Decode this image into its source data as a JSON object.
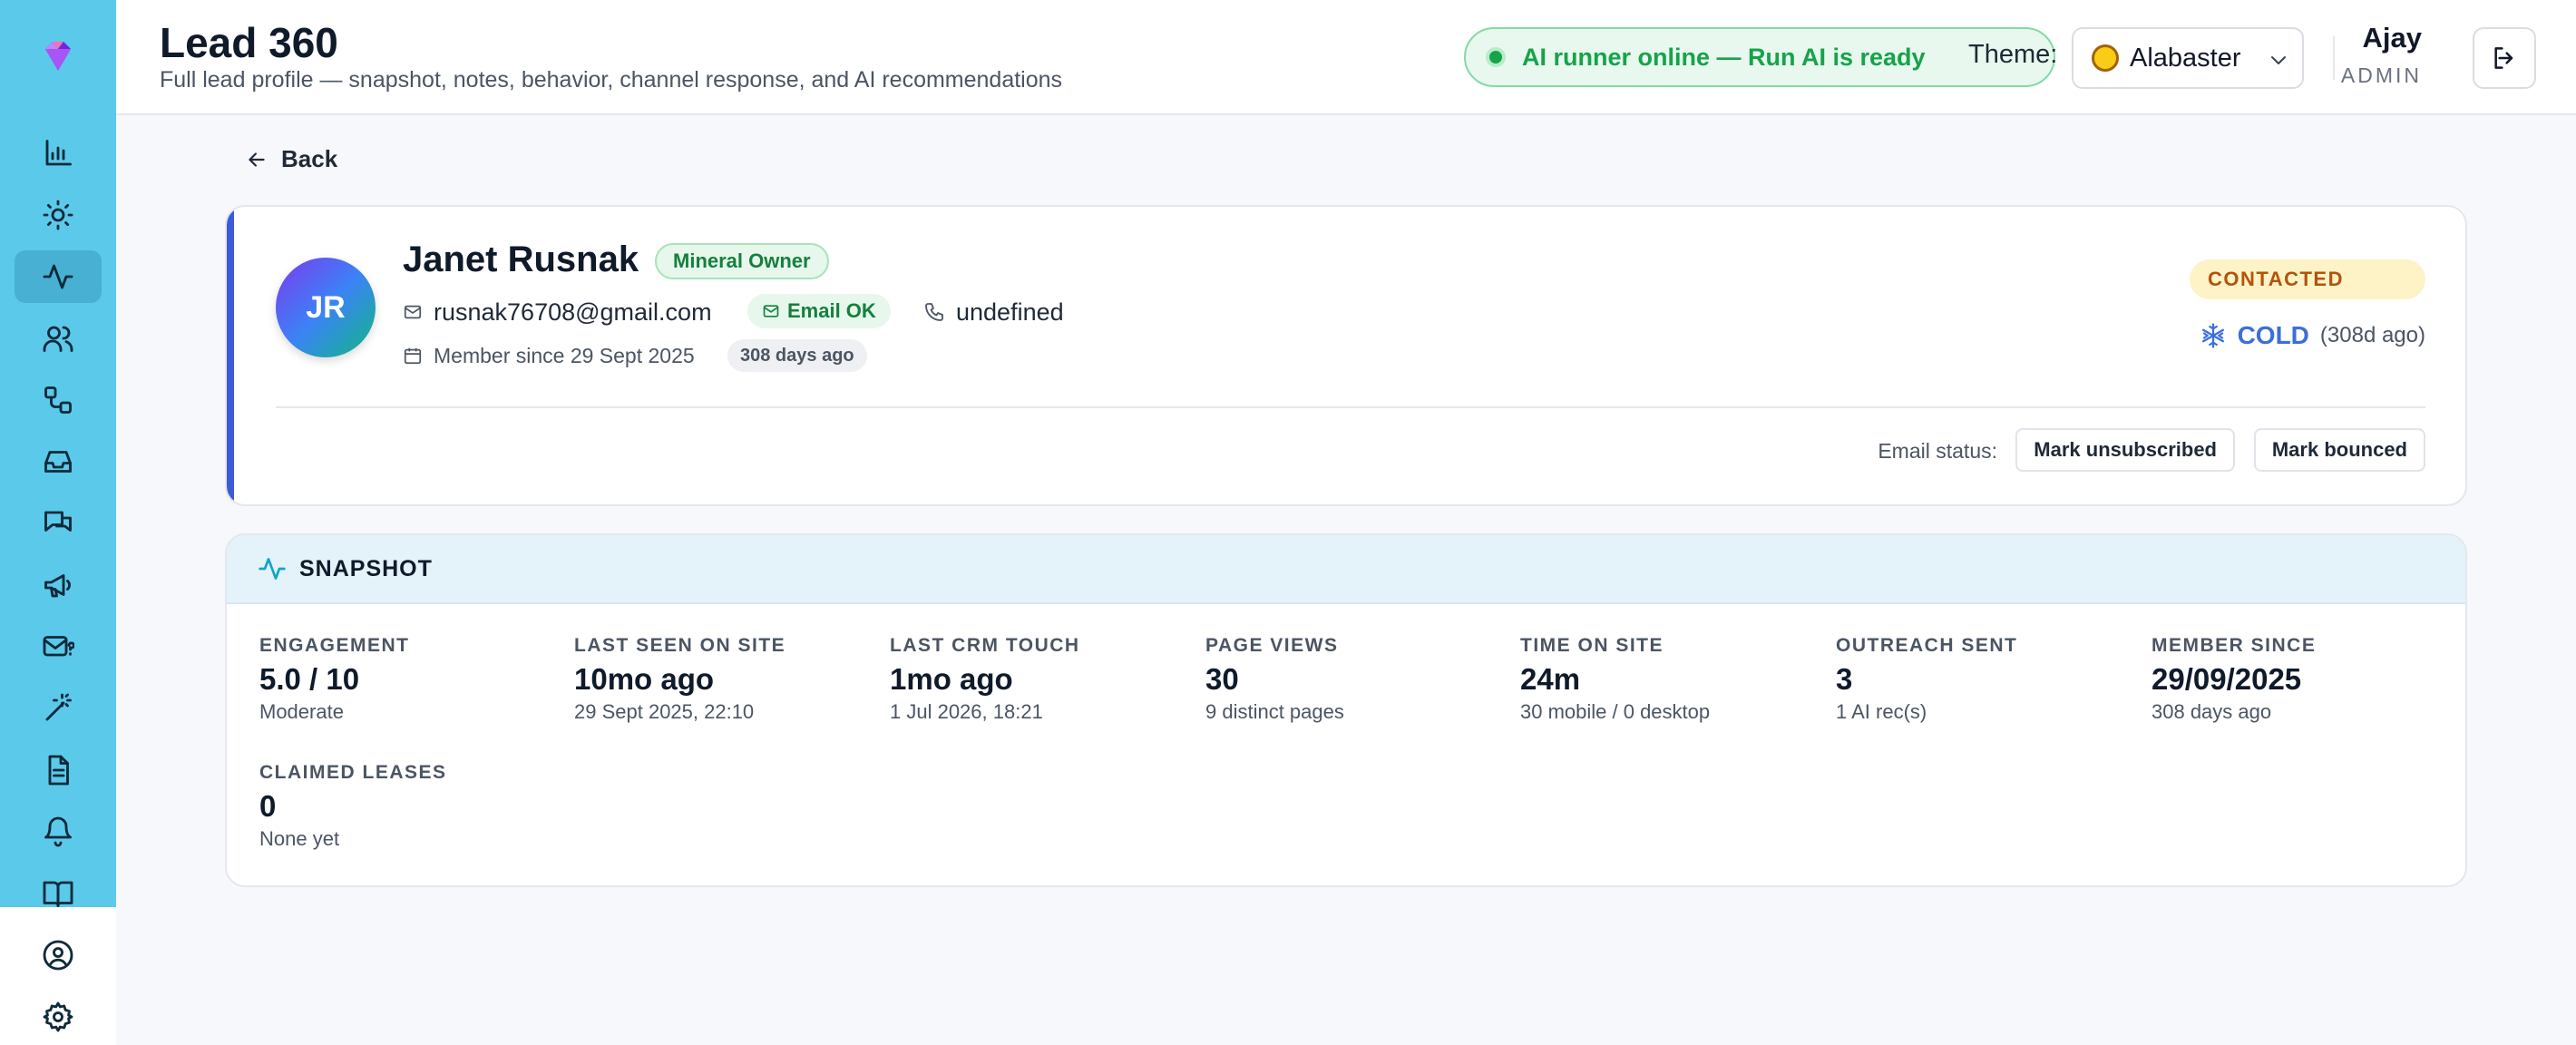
{
  "header": {
    "title": "Lead 360",
    "subtitle": "Full lead profile — snapshot, notes, behavior, channel response, and AI recommendations",
    "ai_status": "AI runner online — Run AI is ready",
    "theme_label": "Theme:",
    "theme_value": "Alabaster",
    "user_name": "Ajay",
    "user_role": "ADMIN",
    "logout_icon": "logout-icon"
  },
  "sidebar": {
    "items": [
      {
        "icon": "bar-chart-icon",
        "active": false
      },
      {
        "icon": "sun-icon",
        "active": false
      },
      {
        "icon": "activity-icon",
        "active": true
      },
      {
        "icon": "users-icon",
        "active": false
      },
      {
        "icon": "workflow-icon",
        "active": false
      },
      {
        "icon": "inbox-icon",
        "active": false
      },
      {
        "icon": "messages-icon",
        "active": false
      },
      {
        "icon": "megaphone-icon",
        "active": false
      },
      {
        "icon": "mail-question-icon",
        "active": false
      },
      {
        "icon": "magic-wand-icon",
        "active": false
      },
      {
        "icon": "document-icon",
        "active": false
      },
      {
        "icon": "bell-icon",
        "active": false
      },
      {
        "icon": "book-icon",
        "active": false
      },
      {
        "icon": "user-circle-icon",
        "active": false
      },
      {
        "icon": "settings-icon",
        "active": false
      }
    ]
  },
  "back_label": "Back",
  "profile": {
    "initials": "JR",
    "name": "Janet Rusnak",
    "role_badge": "Mineral Owner",
    "email": "rusnak76708@gmail.com",
    "email_ok": "Email OK",
    "phone": "undefined",
    "member_since": "Member since 29 Sept 2025",
    "days_ago": "308 days ago",
    "status": "CONTACTED",
    "temperature": "COLD",
    "temperature_age": "(308d ago)",
    "email_status_label": "Email status:",
    "mark_unsubscribed": "Mark unsubscribed",
    "mark_bounced": "Mark bounced"
  },
  "snapshot": {
    "title": "SNAPSHOT",
    "stats": [
      {
        "label": "ENGAGEMENT",
        "value": "5.0 / 10",
        "sub": "Moderate"
      },
      {
        "label": "LAST SEEN ON SITE",
        "value": "10mo ago",
        "sub": "29 Sept 2025, 22:10"
      },
      {
        "label": "LAST CRM TOUCH",
        "value": "1mo ago",
        "sub": "1 Jul 2026, 18:21"
      },
      {
        "label": "PAGE VIEWS",
        "value": "30",
        "sub": "9 distinct pages"
      },
      {
        "label": "TIME ON SITE",
        "value": "24m",
        "sub": "30 mobile / 0 desktop"
      },
      {
        "label": "OUTREACH SENT",
        "value": "3",
        "sub": "1 AI rec(s)"
      },
      {
        "label": "MEMBER SINCE",
        "value": "29/09/2025",
        "sub": "308 days ago"
      },
      {
        "label": "CLAIMED LEASES",
        "value": "0",
        "sub": "None yet"
      }
    ]
  },
  "colors": {
    "sidebar": "#5bc9ea",
    "accent": "#3b5bdb",
    "success": "#16a34a",
    "warning": "#b45309",
    "cold": "#3b6fd8"
  }
}
